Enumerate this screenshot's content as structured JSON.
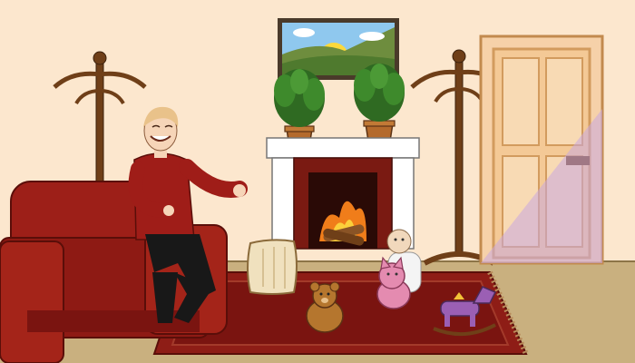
{
  "scene": {
    "colors": {
      "wall": "#FCE7CE",
      "floor": "#C9B07F",
      "rug": "#8E1D16",
      "rug_inner": "#7A1410",
      "sofa": "#9D1F18",
      "sweater": "#9F1D18",
      "pants": "#181818",
      "hair": "#E9C28A",
      "skin": "#F6D5B8",
      "wood": "#6F3F18",
      "door": "#F6D1A9",
      "door_shadow": "#D9BFE0",
      "fireplace": "#FFFFFF",
      "brick": "#7A1A12",
      "fire": "#F07D1A",
      "plant": "#2F6A22",
      "pot": "#B46A2C",
      "pillow": "#F0E1BE"
    },
    "objects": [
      "landscape-painting",
      "fireplace",
      "potted-plant",
      "potted-plant",
      "coat-rack",
      "coat-rack",
      "door",
      "armchair",
      "smiling-man",
      "pillow",
      "rug",
      "teddy-bear",
      "pink-cat-plush",
      "baby-doll",
      "rocking-horse-toy"
    ]
  }
}
